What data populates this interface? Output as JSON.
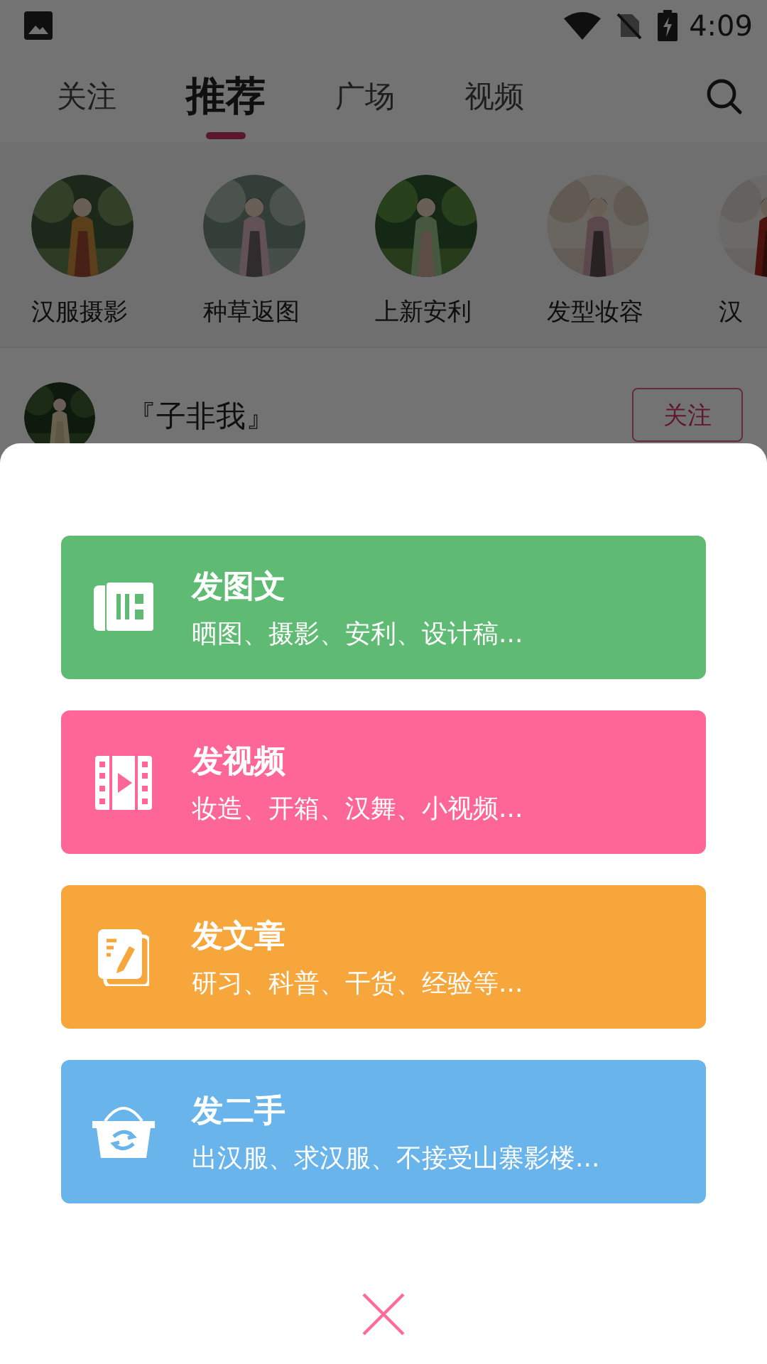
{
  "status_bar": {
    "time": "4:09"
  },
  "tabs": [
    {
      "label": "关注",
      "selected": false
    },
    {
      "label": "推荐",
      "selected": true
    },
    {
      "label": "广场",
      "selected": false
    },
    {
      "label": "视频",
      "selected": false
    }
  ],
  "categories": [
    {
      "label": "汉服摄影"
    },
    {
      "label": "种草返图"
    },
    {
      "label": "上新安利"
    },
    {
      "label": "发型妆容"
    },
    {
      "label": "汉"
    }
  ],
  "post": {
    "author": "『子非我』",
    "follow_button": "关注"
  },
  "publish_menu": {
    "options": [
      {
        "title": "发图文",
        "subtitle": "晒图、摄影、安利、设计稿...",
        "color": "#5fbb74"
      },
      {
        "title": "发视频",
        "subtitle": "妆造、开箱、汉舞、小视频...",
        "color": "#ff6698"
      },
      {
        "title": "发文章",
        "subtitle": "研习、科普、干货、经验等...",
        "color": "#f6a63a"
      },
      {
        "title": "发二手",
        "subtitle": "出汉服、求汉服、不接受山寨影楼...",
        "color": "#6ab4ec"
      }
    ]
  }
}
